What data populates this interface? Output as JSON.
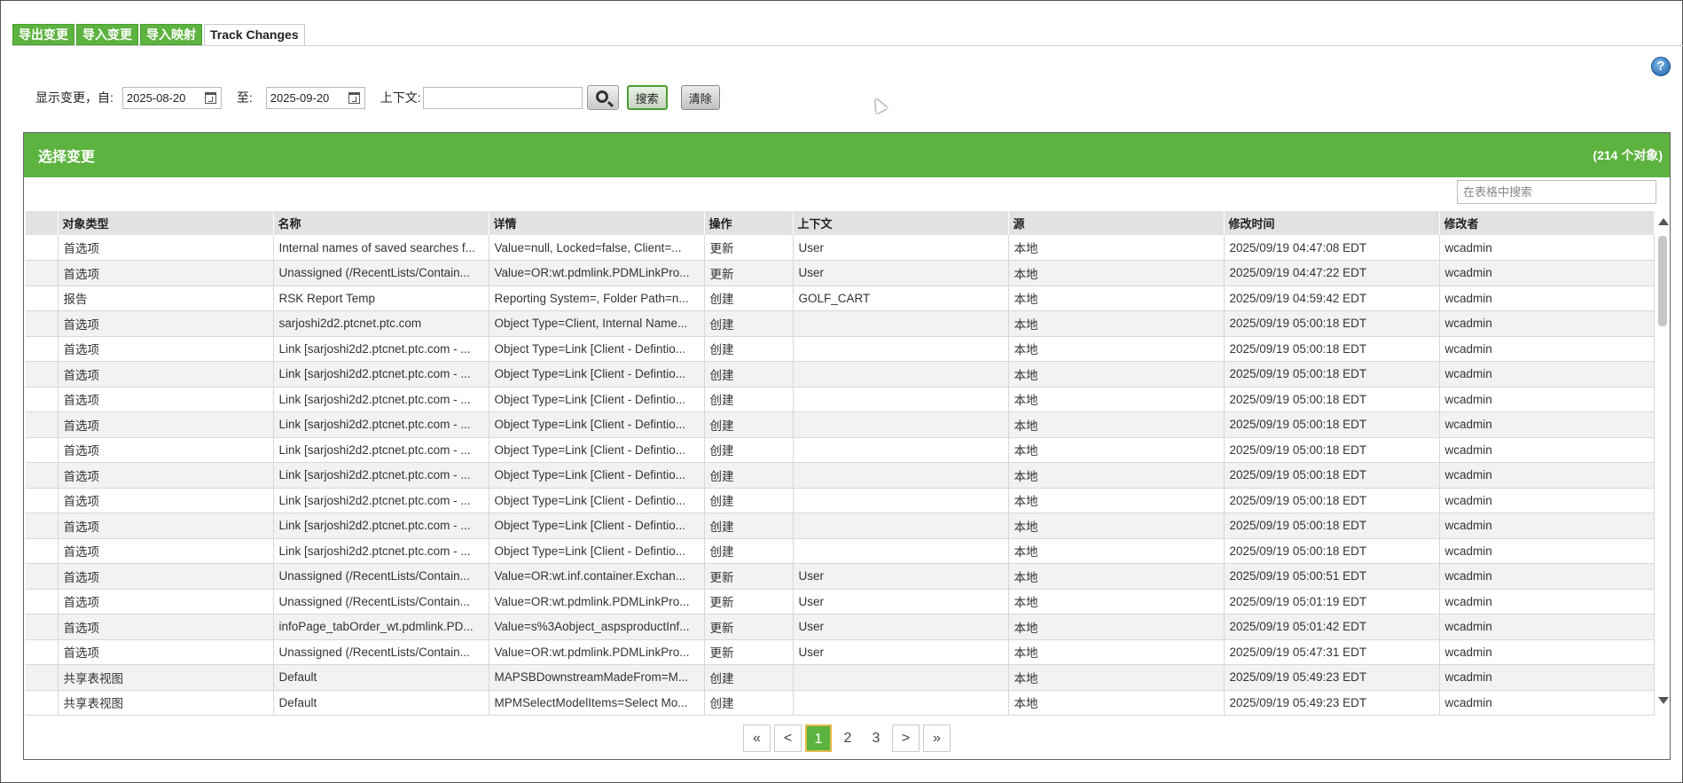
{
  "tabs": [
    {
      "label": "导出变更",
      "active": false
    },
    {
      "label": "导入变更",
      "active": false
    },
    {
      "label": "导入映射",
      "active": false
    },
    {
      "label": "Track Changes",
      "active": true
    }
  ],
  "help_icon": "?",
  "filters": {
    "from_label": "显示变更，自:",
    "from_date": "2025-08-20",
    "to_label": "至:",
    "to_date": "2025-09-20",
    "context_label": "上下文:",
    "context_value": "",
    "search_label": "搜索",
    "clear_label": "清除"
  },
  "panel": {
    "title": "选择变更",
    "count": "(214 个对象)",
    "table_search_placeholder": "在表格中搜索"
  },
  "table": {
    "columns": [
      "",
      "对象类型",
      "名称",
      "详情",
      "操作",
      "上下文",
      "源",
      "修改时间",
      "修改者"
    ],
    "rows": [
      [
        "",
        "首选项",
        "Internal names of saved searches f...",
        "Value=null, Locked=false, Client=...",
        "更新",
        "User",
        "本地",
        "2025/09/19 04:47:08 EDT",
        "wcadmin"
      ],
      [
        "",
        "首选项",
        "Unassigned (/RecentLists/Contain...",
        "Value=OR:wt.pdmlink.PDMLinkPro...",
        "更新",
        "User",
        "本地",
        "2025/09/19 04:47:22 EDT",
        "wcadmin"
      ],
      [
        "",
        "报告",
        "RSK Report Temp",
        "Reporting System=, Folder Path=n...",
        "创建",
        "GOLF_CART",
        "本地",
        "2025/09/19 04:59:42 EDT",
        "wcadmin"
      ],
      [
        "",
        "首选项",
        "sarjoshi2d2.ptcnet.ptc.com",
        "Object Type=Client, Internal Name...",
        "创建",
        "",
        "本地",
        "2025/09/19 05:00:18 EDT",
        "wcadmin"
      ],
      [
        "",
        "首选项",
        "Link [sarjoshi2d2.ptcnet.ptc.com - ...",
        "Object Type=Link [Client - Defintio...",
        "创建",
        "",
        "本地",
        "2025/09/19 05:00:18 EDT",
        "wcadmin"
      ],
      [
        "",
        "首选项",
        "Link [sarjoshi2d2.ptcnet.ptc.com - ...",
        "Object Type=Link [Client - Defintio...",
        "创建",
        "",
        "本地",
        "2025/09/19 05:00:18 EDT",
        "wcadmin"
      ],
      [
        "",
        "首选项",
        "Link [sarjoshi2d2.ptcnet.ptc.com - ...",
        "Object Type=Link [Client - Defintio...",
        "创建",
        "",
        "本地",
        "2025/09/19 05:00:18 EDT",
        "wcadmin"
      ],
      [
        "",
        "首选项",
        "Link [sarjoshi2d2.ptcnet.ptc.com - ...",
        "Object Type=Link [Client - Defintio...",
        "创建",
        "",
        "本地",
        "2025/09/19 05:00:18 EDT",
        "wcadmin"
      ],
      [
        "",
        "首选项",
        "Link [sarjoshi2d2.ptcnet.ptc.com - ...",
        "Object Type=Link [Client - Defintio...",
        "创建",
        "",
        "本地",
        "2025/09/19 05:00:18 EDT",
        "wcadmin"
      ],
      [
        "",
        "首选项",
        "Link [sarjoshi2d2.ptcnet.ptc.com - ...",
        "Object Type=Link [Client - Defintio...",
        "创建",
        "",
        "本地",
        "2025/09/19 05:00:18 EDT",
        "wcadmin"
      ],
      [
        "",
        "首选项",
        "Link [sarjoshi2d2.ptcnet.ptc.com - ...",
        "Object Type=Link [Client - Defintio...",
        "创建",
        "",
        "本地",
        "2025/09/19 05:00:18 EDT",
        "wcadmin"
      ],
      [
        "",
        "首选项",
        "Link [sarjoshi2d2.ptcnet.ptc.com - ...",
        "Object Type=Link [Client - Defintio...",
        "创建",
        "",
        "本地",
        "2025/09/19 05:00:18 EDT",
        "wcadmin"
      ],
      [
        "",
        "首选项",
        "Link [sarjoshi2d2.ptcnet.ptc.com - ...",
        "Object Type=Link [Client - Defintio...",
        "创建",
        "",
        "本地",
        "2025/09/19 05:00:18 EDT",
        "wcadmin"
      ],
      [
        "",
        "首选项",
        "Unassigned (/RecentLists/Contain...",
        "Value=OR:wt.inf.container.Exchan...",
        "更新",
        "User",
        "本地",
        "2025/09/19 05:00:51 EDT",
        "wcadmin"
      ],
      [
        "",
        "首选项",
        "Unassigned (/RecentLists/Contain...",
        "Value=OR:wt.pdmlink.PDMLinkPro...",
        "更新",
        "User",
        "本地",
        "2025/09/19 05:01:19 EDT",
        "wcadmin"
      ],
      [
        "",
        "首选项",
        "infoPage_tabOrder_wt.pdmlink.PD...",
        "Value=s%3Aobject_aspsproductInf...",
        "更新",
        "User",
        "本地",
        "2025/09/19 05:01:42 EDT",
        "wcadmin"
      ],
      [
        "",
        "首选项",
        "Unassigned (/RecentLists/Contain...",
        "Value=OR:wt.pdmlink.PDMLinkPro...",
        "更新",
        "User",
        "本地",
        "2025/09/19 05:47:31 EDT",
        "wcadmin"
      ],
      [
        "",
        "共享表视图",
        "Default",
        "MAPSBDownstreamMadeFrom=M...",
        "创建",
        "",
        "本地",
        "2025/09/19 05:49:23 EDT",
        "wcadmin"
      ],
      [
        "",
        "共享表视图",
        "Default",
        "MPMSelectModelItems=Select Mo...",
        "创建",
        "",
        "本地",
        "2025/09/19 05:49:23 EDT",
        "wcadmin"
      ]
    ]
  },
  "pager": {
    "first": "«",
    "prev": "<",
    "pages": [
      "1",
      "2",
      "3"
    ],
    "current": "1",
    "next": ">",
    "last": "»"
  },
  "colors": {
    "accent": "#5cb33f",
    "current_page_border": "#e0b94a"
  }
}
